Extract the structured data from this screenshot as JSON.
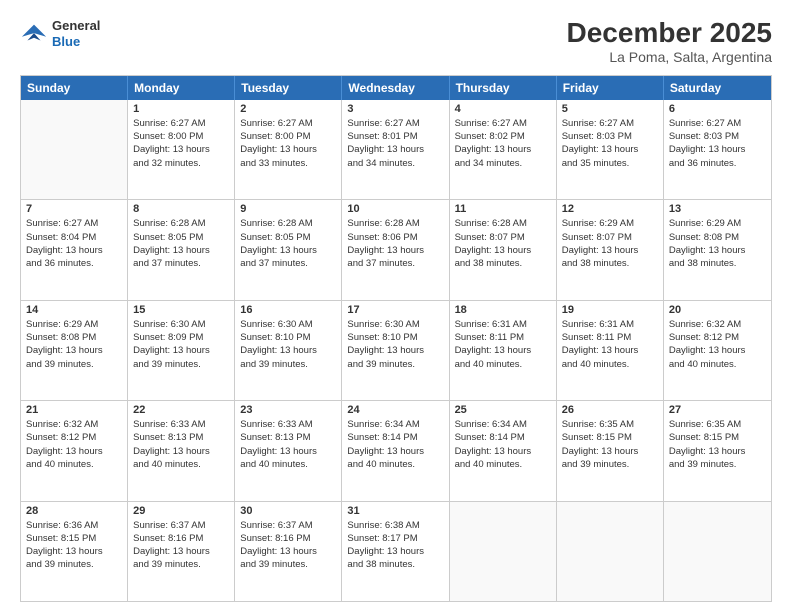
{
  "logo": {
    "general": "General",
    "blue": "Blue"
  },
  "title": "December 2025",
  "subtitle": "La Poma, Salta, Argentina",
  "header_days": [
    "Sunday",
    "Monday",
    "Tuesday",
    "Wednesday",
    "Thursday",
    "Friday",
    "Saturday"
  ],
  "weeks": [
    [
      {
        "day": "",
        "info": ""
      },
      {
        "day": "1",
        "info": "Sunrise: 6:27 AM\nSunset: 8:00 PM\nDaylight: 13 hours\nand 32 minutes."
      },
      {
        "day": "2",
        "info": "Sunrise: 6:27 AM\nSunset: 8:00 PM\nDaylight: 13 hours\nand 33 minutes."
      },
      {
        "day": "3",
        "info": "Sunrise: 6:27 AM\nSunset: 8:01 PM\nDaylight: 13 hours\nand 34 minutes."
      },
      {
        "day": "4",
        "info": "Sunrise: 6:27 AM\nSunset: 8:02 PM\nDaylight: 13 hours\nand 34 minutes."
      },
      {
        "day": "5",
        "info": "Sunrise: 6:27 AM\nSunset: 8:03 PM\nDaylight: 13 hours\nand 35 minutes."
      },
      {
        "day": "6",
        "info": "Sunrise: 6:27 AM\nSunset: 8:03 PM\nDaylight: 13 hours\nand 36 minutes."
      }
    ],
    [
      {
        "day": "7",
        "info": "Sunrise: 6:27 AM\nSunset: 8:04 PM\nDaylight: 13 hours\nand 36 minutes."
      },
      {
        "day": "8",
        "info": "Sunrise: 6:28 AM\nSunset: 8:05 PM\nDaylight: 13 hours\nand 37 minutes."
      },
      {
        "day": "9",
        "info": "Sunrise: 6:28 AM\nSunset: 8:05 PM\nDaylight: 13 hours\nand 37 minutes."
      },
      {
        "day": "10",
        "info": "Sunrise: 6:28 AM\nSunset: 8:06 PM\nDaylight: 13 hours\nand 37 minutes."
      },
      {
        "day": "11",
        "info": "Sunrise: 6:28 AM\nSunset: 8:07 PM\nDaylight: 13 hours\nand 38 minutes."
      },
      {
        "day": "12",
        "info": "Sunrise: 6:29 AM\nSunset: 8:07 PM\nDaylight: 13 hours\nand 38 minutes."
      },
      {
        "day": "13",
        "info": "Sunrise: 6:29 AM\nSunset: 8:08 PM\nDaylight: 13 hours\nand 38 minutes."
      }
    ],
    [
      {
        "day": "14",
        "info": "Sunrise: 6:29 AM\nSunset: 8:08 PM\nDaylight: 13 hours\nand 39 minutes."
      },
      {
        "day": "15",
        "info": "Sunrise: 6:30 AM\nSunset: 8:09 PM\nDaylight: 13 hours\nand 39 minutes."
      },
      {
        "day": "16",
        "info": "Sunrise: 6:30 AM\nSunset: 8:10 PM\nDaylight: 13 hours\nand 39 minutes."
      },
      {
        "day": "17",
        "info": "Sunrise: 6:30 AM\nSunset: 8:10 PM\nDaylight: 13 hours\nand 39 minutes."
      },
      {
        "day": "18",
        "info": "Sunrise: 6:31 AM\nSunset: 8:11 PM\nDaylight: 13 hours\nand 40 minutes."
      },
      {
        "day": "19",
        "info": "Sunrise: 6:31 AM\nSunset: 8:11 PM\nDaylight: 13 hours\nand 40 minutes."
      },
      {
        "day": "20",
        "info": "Sunrise: 6:32 AM\nSunset: 8:12 PM\nDaylight: 13 hours\nand 40 minutes."
      }
    ],
    [
      {
        "day": "21",
        "info": "Sunrise: 6:32 AM\nSunset: 8:12 PM\nDaylight: 13 hours\nand 40 minutes."
      },
      {
        "day": "22",
        "info": "Sunrise: 6:33 AM\nSunset: 8:13 PM\nDaylight: 13 hours\nand 40 minutes."
      },
      {
        "day": "23",
        "info": "Sunrise: 6:33 AM\nSunset: 8:13 PM\nDaylight: 13 hours\nand 40 minutes."
      },
      {
        "day": "24",
        "info": "Sunrise: 6:34 AM\nSunset: 8:14 PM\nDaylight: 13 hours\nand 40 minutes."
      },
      {
        "day": "25",
        "info": "Sunrise: 6:34 AM\nSunset: 8:14 PM\nDaylight: 13 hours\nand 40 minutes."
      },
      {
        "day": "26",
        "info": "Sunrise: 6:35 AM\nSunset: 8:15 PM\nDaylight: 13 hours\nand 39 minutes."
      },
      {
        "day": "27",
        "info": "Sunrise: 6:35 AM\nSunset: 8:15 PM\nDaylight: 13 hours\nand 39 minutes."
      }
    ],
    [
      {
        "day": "28",
        "info": "Sunrise: 6:36 AM\nSunset: 8:15 PM\nDaylight: 13 hours\nand 39 minutes."
      },
      {
        "day": "29",
        "info": "Sunrise: 6:37 AM\nSunset: 8:16 PM\nDaylight: 13 hours\nand 39 minutes."
      },
      {
        "day": "30",
        "info": "Sunrise: 6:37 AM\nSunset: 8:16 PM\nDaylight: 13 hours\nand 39 minutes."
      },
      {
        "day": "31",
        "info": "Sunrise: 6:38 AM\nSunset: 8:17 PM\nDaylight: 13 hours\nand 38 minutes."
      },
      {
        "day": "",
        "info": ""
      },
      {
        "day": "",
        "info": ""
      },
      {
        "day": "",
        "info": ""
      }
    ]
  ]
}
